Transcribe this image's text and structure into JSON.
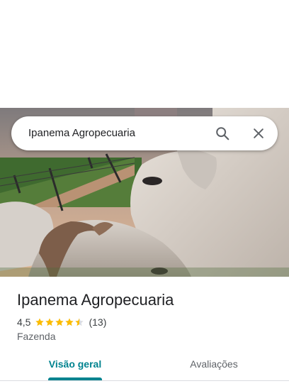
{
  "search": {
    "query": "Ipanema Agropecuaria"
  },
  "icons": {
    "search": "search-icon",
    "close": "close-icon",
    "star": "star-icon"
  },
  "place": {
    "name": "Ipanema Agropecuaria",
    "rating": "4,5",
    "rating_value": 4.5,
    "stars_total": 5,
    "review_count": "(13)",
    "category": "Fazenda"
  },
  "tabs": [
    {
      "label": "Visão geral",
      "active": true
    },
    {
      "label": "Avaliações",
      "active": false
    }
  ],
  "colors": {
    "accent": "#00838f",
    "star": "#fbbc04",
    "star_empty": "#dadce0"
  }
}
